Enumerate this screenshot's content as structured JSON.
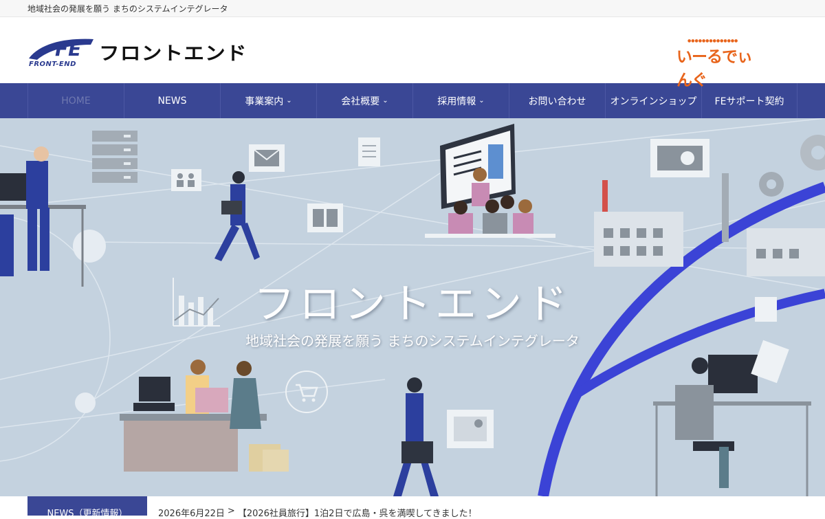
{
  "topbar": {
    "tagline": "地域社会の発展を願う まちのシステムインテグレータ"
  },
  "header": {
    "logo_mark": "FE",
    "logo_sub": "FRONT-END",
    "logo_name": "フロントエンド",
    "partner_name": "いーるでぃんぐ"
  },
  "nav": {
    "items": [
      {
        "label": "HOME",
        "has_dropdown": false
      },
      {
        "label": "NEWS",
        "has_dropdown": false
      },
      {
        "label": "事業案内",
        "has_dropdown": true
      },
      {
        "label": "会社概要",
        "has_dropdown": true
      },
      {
        "label": "採用情報",
        "has_dropdown": true
      },
      {
        "label": "お問い合わせ",
        "has_dropdown": false
      },
      {
        "label": "オンラインショップ",
        "has_dropdown": false
      },
      {
        "label": "FEサポート契約",
        "has_dropdown": false
      }
    ],
    "chevron_icon": "chevron-down-icon"
  },
  "hero": {
    "title": "フロントエンド",
    "subtitle": "地域社会の発展を願う まちのシステムインテグレータ"
  },
  "news": {
    "label": "NEWS（更新情報）",
    "date": "2026年6月22日",
    "separator": ">",
    "headline": "【2026社員旅行】1泊2日で広島・呉を満喫してきました！"
  },
  "colors": {
    "nav_bg": "#3a4795",
    "hero_bg": "#c4d2df",
    "accent_orange": "#e8641b",
    "arc_blue": "#3b43d6"
  }
}
